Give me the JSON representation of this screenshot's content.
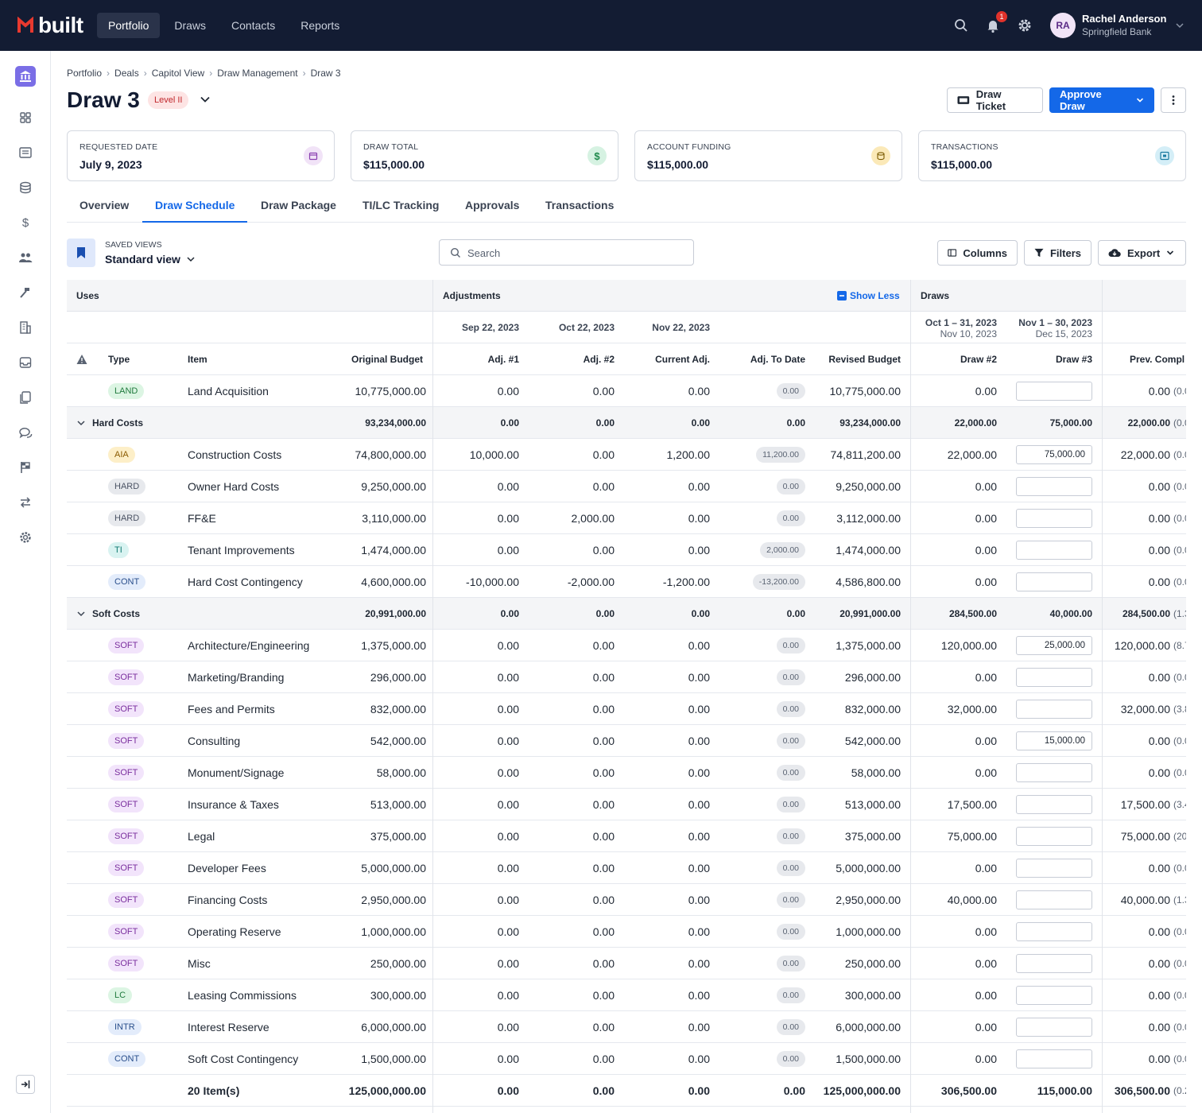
{
  "app": {
    "name": "built"
  },
  "topnav": {
    "tabs": [
      "Portfolio",
      "Draws",
      "Contacts",
      "Reports"
    ],
    "active_tab": "Portfolio",
    "notification_count": "1",
    "user": {
      "initials": "RA",
      "name": "Rachel Anderson",
      "org": "Springfield Bank"
    }
  },
  "breadcrumb": [
    "Portfolio",
    "Deals",
    "Capitol View",
    "Draw Management",
    "Draw 3"
  ],
  "page": {
    "title": "Draw 3",
    "level": "Level II"
  },
  "actions": {
    "draw_ticket": "Draw Ticket",
    "approve": "Approve Draw"
  },
  "cards": [
    {
      "label": "REQUESTED DATE",
      "value": "July 9, 2023",
      "icon": "calendar-icon",
      "color": "#f1e3f7"
    },
    {
      "label": "DRAW TOTAL",
      "value": "$115,000.00",
      "icon": "dollar-icon",
      "color": "#d6f2e2"
    },
    {
      "label": "ACCOUNT FUNDING",
      "value": "$115,000.00",
      "icon": "coins-icon",
      "color": "#fbe9b8"
    },
    {
      "label": "TRANSACTIONS",
      "value": "$115,000.00",
      "icon": "transfer-icon",
      "color": "#d4eef7"
    }
  ],
  "tabs": [
    "Overview",
    "Draw Schedule",
    "Draw Package",
    "TI/LC Tracking",
    "Approvals",
    "Transactions"
  ],
  "active_tab": "Draw Schedule",
  "toolbar": {
    "saved_views_label": "SAVED VIEWS",
    "saved_view": "Standard view",
    "search_placeholder": "Search",
    "columns": "Columns",
    "filters": "Filters",
    "export": "Export"
  },
  "table": {
    "group_headers": {
      "uses": "Uses",
      "adjustments": "Adjustments",
      "show_less": "Show Less",
      "draws": "Draws"
    },
    "date_headers": {
      "adj1": "Sep 22, 2023",
      "adj2": "Oct 22, 2023",
      "current": "Nov 22, 2023",
      "draw2_range": "Oct 1 – 31, 2023",
      "draw2_date": "Nov 10, 2023",
      "draw3_range": "Nov 1 – 30, 2023",
      "draw3_date": "Dec 15, 2023"
    },
    "columns": {
      "type": "Type",
      "item": "Item",
      "original": "Original Budget",
      "adj1": "Adj. #1",
      "adj2": "Adj. #2",
      "current": "Current Adj.",
      "to_date": "Adj. To Date",
      "revised": "Revised Budget",
      "draw2": "Draw #2",
      "draw3": "Draw #3",
      "prev": "Prev. Compl"
    },
    "rows": [
      {
        "kind": "item",
        "tag": "LAND",
        "item": "Land Acquisition",
        "original": "10,775,000.00",
        "adj1": "0.00",
        "adj2": "0.00",
        "current": "0.00",
        "to_date": "0.00",
        "revised": "10,775,000.00",
        "draw2": "0.00",
        "draw3": "",
        "prev": "0.00",
        "prev_sub": "(0.0"
      },
      {
        "kind": "group",
        "item": "Hard Costs",
        "original": "93,234,000.00",
        "adj1": "0.00",
        "adj2": "0.00",
        "current": "0.00",
        "to_date": "0.00",
        "revised": "93,234,000.00",
        "draw2": "22,000.00",
        "draw3": "75,000.00",
        "prev": "22,000.00",
        "prev_sub": "(0.0"
      },
      {
        "kind": "item",
        "tag": "AIA",
        "item": "Construction Costs",
        "original": "74,800,000.00",
        "adj1": "10,000.00",
        "adj2": "0.00",
        "current": "1,200.00",
        "to_date": "11,200.00",
        "revised": "74,811,200.00",
        "draw2": "22,000.00",
        "draw3": "75,000.00",
        "prev": "22,000.00",
        "prev_sub": "(0.0"
      },
      {
        "kind": "item",
        "tag": "HARD",
        "item": "Owner Hard Costs",
        "original": "9,250,000.00",
        "adj1": "0.00",
        "adj2": "0.00",
        "current": "0.00",
        "to_date": "0.00",
        "revised": "9,250,000.00",
        "draw2": "0.00",
        "draw3": "",
        "prev": "0.00",
        "prev_sub": "(0.0"
      },
      {
        "kind": "item",
        "tag": "HARD",
        "item": "FF&E",
        "original": "3,110,000.00",
        "adj1": "0.00",
        "adj2": "2,000.00",
        "current": "0.00",
        "to_date": "0.00",
        "revised": "3,112,000.00",
        "draw2": "0.00",
        "draw3": "",
        "prev": "0.00",
        "prev_sub": "(0.0"
      },
      {
        "kind": "item",
        "tag": "TI",
        "item": "Tenant Improvements",
        "original": "1,474,000.00",
        "adj1": "0.00",
        "adj2": "0.00",
        "current": "0.00",
        "to_date": "2,000.00",
        "revised": "1,474,000.00",
        "draw2": "0.00",
        "draw3": "",
        "prev": "0.00",
        "prev_sub": "(0.0"
      },
      {
        "kind": "item",
        "tag": "CONT",
        "item": "Hard Cost Contingency",
        "original": "4,600,000.00",
        "adj1": "-10,000.00",
        "adj2": "-2,000.00",
        "current": "-1,200.00",
        "to_date": "-13,200.00",
        "revised": "4,586,800.00",
        "draw2": "0.00",
        "draw3": "",
        "prev": "0.00",
        "prev_sub": "(0.0"
      },
      {
        "kind": "group",
        "item": "Soft Costs",
        "original": "20,991,000.00",
        "adj1": "0.00",
        "adj2": "0.00",
        "current": "0.00",
        "to_date": "0.00",
        "revised": "20,991,000.00",
        "draw2": "284,500.00",
        "draw3": "40,000.00",
        "prev": "284,500.00",
        "prev_sub": "(1.3"
      },
      {
        "kind": "item",
        "tag": "SOFT",
        "item": "Architecture/Engineering",
        "original": "1,375,000.00",
        "adj1": "0.00",
        "adj2": "0.00",
        "current": "0.00",
        "to_date": "0.00",
        "revised": "1,375,000.00",
        "draw2": "120,000.00",
        "draw3": "25,000.00",
        "prev": "120,000.00",
        "prev_sub": "(8.7"
      },
      {
        "kind": "item",
        "tag": "SOFT",
        "item": "Marketing/Branding",
        "original": "296,000.00",
        "adj1": "0.00",
        "adj2": "0.00",
        "current": "0.00",
        "to_date": "0.00",
        "revised": "296,000.00",
        "draw2": "0.00",
        "draw3": "",
        "prev": "0.00",
        "prev_sub": "(0.0"
      },
      {
        "kind": "item",
        "tag": "SOFT",
        "item": "Fees and Permits",
        "original": "832,000.00",
        "adj1": "0.00",
        "adj2": "0.00",
        "current": "0.00",
        "to_date": "0.00",
        "revised": "832,000.00",
        "draw2": "32,000.00",
        "draw3": "",
        "prev": "32,000.00",
        "prev_sub": "(3.8"
      },
      {
        "kind": "item",
        "tag": "SOFT",
        "item": "Consulting",
        "original": "542,000.00",
        "adj1": "0.00",
        "adj2": "0.00",
        "current": "0.00",
        "to_date": "0.00",
        "revised": "542,000.00",
        "draw2": "0.00",
        "draw3": "15,000.00",
        "prev": "0.00",
        "prev_sub": "(0.0"
      },
      {
        "kind": "item",
        "tag": "SOFT",
        "item": "Monument/Signage",
        "original": "58,000.00",
        "adj1": "0.00",
        "adj2": "0.00",
        "current": "0.00",
        "to_date": "0.00",
        "revised": "58,000.00",
        "draw2": "0.00",
        "draw3": "",
        "prev": "0.00",
        "prev_sub": "(0.0"
      },
      {
        "kind": "item",
        "tag": "SOFT",
        "item": "Insurance & Taxes",
        "original": "513,000.00",
        "adj1": "0.00",
        "adj2": "0.00",
        "current": "0.00",
        "to_date": "0.00",
        "revised": "513,000.00",
        "draw2": "17,500.00",
        "draw3": "",
        "prev": "17,500.00",
        "prev_sub": "(3.4"
      },
      {
        "kind": "item",
        "tag": "SOFT",
        "item": "Legal",
        "original": "375,000.00",
        "adj1": "0.00",
        "adj2": "0.00",
        "current": "0.00",
        "to_date": "0.00",
        "revised": "375,000.00",
        "draw2": "75,000.00",
        "draw3": "",
        "prev": "75,000.00",
        "prev_sub": "(20.0"
      },
      {
        "kind": "item",
        "tag": "SOFT",
        "item": "Developer Fees",
        "original": "5,000,000.00",
        "adj1": "0.00",
        "adj2": "0.00",
        "current": "0.00",
        "to_date": "0.00",
        "revised": "5,000,000.00",
        "draw2": "0.00",
        "draw3": "",
        "prev": "0.00",
        "prev_sub": "(0.0"
      },
      {
        "kind": "item",
        "tag": "SOFT",
        "item": "Financing Costs",
        "original": "2,950,000.00",
        "adj1": "0.00",
        "adj2": "0.00",
        "current": "0.00",
        "to_date": "0.00",
        "revised": "2,950,000.00",
        "draw2": "40,000.00",
        "draw3": "",
        "prev": "40,000.00",
        "prev_sub": "(1.3"
      },
      {
        "kind": "item",
        "tag": "SOFT",
        "item": "Operating Reserve",
        "original": "1,000,000.00",
        "adj1": "0.00",
        "adj2": "0.00",
        "current": "0.00",
        "to_date": "0.00",
        "revised": "1,000,000.00",
        "draw2": "0.00",
        "draw3": "",
        "prev": "0.00",
        "prev_sub": "(0.0"
      },
      {
        "kind": "item",
        "tag": "SOFT",
        "item": "Misc",
        "original": "250,000.00",
        "adj1": "0.00",
        "adj2": "0.00",
        "current": "0.00",
        "to_date": "0.00",
        "revised": "250,000.00",
        "draw2": "0.00",
        "draw3": "",
        "prev": "0.00",
        "prev_sub": "(0.0"
      },
      {
        "kind": "item",
        "tag": "LC",
        "item": "Leasing Commissions",
        "original": "300,000.00",
        "adj1": "0.00",
        "adj2": "0.00",
        "current": "0.00",
        "to_date": "0.00",
        "revised": "300,000.00",
        "draw2": "0.00",
        "draw3": "",
        "prev": "0.00",
        "prev_sub": "(0.0"
      },
      {
        "kind": "item",
        "tag": "INTR",
        "item": "Interest Reserve",
        "original": "6,000,000.00",
        "adj1": "0.00",
        "adj2": "0.00",
        "current": "0.00",
        "to_date": "0.00",
        "revised": "6,000,000.00",
        "draw2": "0.00",
        "draw3": "",
        "prev": "0.00",
        "prev_sub": "(0.0"
      },
      {
        "kind": "item",
        "tag": "CONT",
        "item": "Soft Cost Contingency",
        "original": "1,500,000.00",
        "adj1": "0.00",
        "adj2": "0.00",
        "current": "0.00",
        "to_date": "0.00",
        "revised": "1,500,000.00",
        "draw2": "0.00",
        "draw3": "",
        "prev": "0.00",
        "prev_sub": "(0.0"
      },
      {
        "kind": "total",
        "item": "20 Item(s)",
        "original": "125,000,000.00",
        "adj1": "0.00",
        "adj2": "0.00",
        "current": "0.00",
        "to_date": "0.00",
        "revised": "125,000,000.00",
        "draw2": "306,500.00",
        "draw3": "115,000.00",
        "prev": "306,500.00",
        "prev_sub": "(0.2"
      }
    ],
    "tag_colors": {
      "LAND": {
        "bg": "#dcf5e3",
        "fg": "#1f7a3d"
      },
      "AIA": {
        "bg": "#fdefc8",
        "fg": "#8a5a00"
      },
      "HARD": {
        "bg": "#e7e9ed",
        "fg": "#4a5263"
      },
      "TI": {
        "bg": "#d9f3f1",
        "fg": "#127a72"
      },
      "CONT": {
        "bg": "#e3ecfb",
        "fg": "#2a4f8c"
      },
      "SOFT": {
        "bg": "#f2e4fb",
        "fg": "#7a2e9e"
      },
      "LC": {
        "bg": "#dcf5e3",
        "fg": "#1f7a3d"
      },
      "INTR": {
        "bg": "#e3ecfb",
        "fg": "#2a4f8c"
      }
    }
  },
  "colors": {
    "nav_bg": "#131c33",
    "accent": "#1468e8",
    "brand_red": "#e8392f"
  }
}
